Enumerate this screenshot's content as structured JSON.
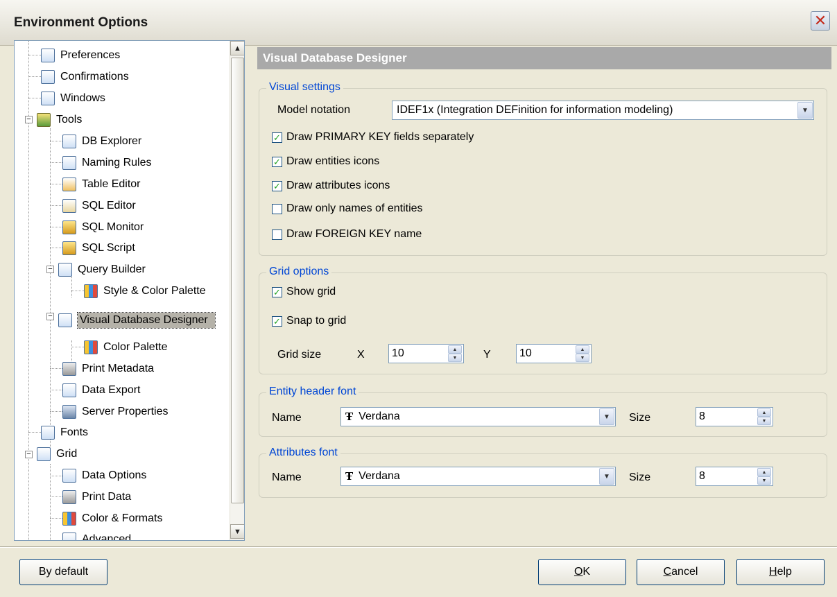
{
  "window": {
    "title": "Environment Options",
    "close_glyph": "✕"
  },
  "tree": {
    "items": [
      {
        "label": "Preferences",
        "icon": "preferences-icon"
      },
      {
        "label": "Confirmations",
        "icon": "confirmations-icon"
      },
      {
        "label": "Windows",
        "icon": "windows-icon"
      },
      {
        "label": "Tools",
        "icon": "tools-icon"
      },
      {
        "label": "DB Explorer",
        "icon": "db-explorer-icon"
      },
      {
        "label": "Naming Rules",
        "icon": "naming-rules-icon"
      },
      {
        "label": "Table Editor",
        "icon": "table-editor-icon"
      },
      {
        "label": "SQL Editor",
        "icon": "sql-editor-icon"
      },
      {
        "label": "SQL Monitor",
        "icon": "sql-monitor-icon"
      },
      {
        "label": "SQL Script",
        "icon": "sql-script-icon"
      },
      {
        "label": "Query Builder",
        "icon": "query-builder-icon"
      },
      {
        "label": "Style & Color Palette",
        "icon": "palette-icon"
      },
      {
        "label": "Visual Database Designer",
        "icon": "designer-icon"
      },
      {
        "label": "Color Palette",
        "icon": "palette-icon"
      },
      {
        "label": "Print Metadata",
        "icon": "printer-icon"
      },
      {
        "label": "Data Export",
        "icon": "data-export-icon"
      },
      {
        "label": "Server Properties",
        "icon": "server-icon"
      },
      {
        "label": "Fonts",
        "icon": "fonts-icon"
      },
      {
        "label": "Grid",
        "icon": "grid-icon"
      },
      {
        "label": "Data Options",
        "icon": "data-options-icon"
      },
      {
        "label": "Print Data",
        "icon": "printer-icon"
      },
      {
        "label": "Color & Formats",
        "icon": "palette-icon"
      },
      {
        "label": "Advanced",
        "icon": "advanced-icon"
      }
    ]
  },
  "page": {
    "header": "Visual Database Designer"
  },
  "visual_settings": {
    "title": "Visual settings",
    "model_notation_label": "Model notation",
    "model_notation_value": "IDEF1x (Integration DEFinition for information modeling)",
    "checkboxes": [
      {
        "label": "Draw PRIMARY KEY fields separately",
        "checked": true
      },
      {
        "label": "Draw entities icons",
        "checked": true
      },
      {
        "label": "Draw attributes icons",
        "checked": true
      },
      {
        "label": "Draw only names of entities",
        "checked": false
      },
      {
        "label": "Draw FOREIGN KEY name",
        "checked": false
      }
    ]
  },
  "grid_options": {
    "title": "Grid options",
    "show_grid": {
      "label": "Show grid",
      "checked": true
    },
    "snap_to_grid": {
      "label": "Snap to grid",
      "checked": true
    },
    "grid_size_label": "Grid size",
    "x_label": "X",
    "x_value": "10",
    "y_label": "Y",
    "y_value": "10"
  },
  "entity_header_font": {
    "title": "Entity header font",
    "name_label": "Name",
    "font_value": "Verdana",
    "size_label": "Size",
    "size_value": "8"
  },
  "attributes_font": {
    "title": "Attributes font",
    "name_label": "Name",
    "font_value": "Verdana",
    "size_label": "Size",
    "size_value": "8"
  },
  "buttons": {
    "by_default": "By default",
    "ok_underlined": "O",
    "ok_rest": "K",
    "cancel_underlined": "C",
    "cancel_rest": "ancel",
    "help_underlined": "H",
    "help_rest": "elp"
  },
  "colors": {
    "accent_title": "#0046d5",
    "header_bg": "#a9a9a9",
    "dialog_bg": "#ece9d8"
  }
}
